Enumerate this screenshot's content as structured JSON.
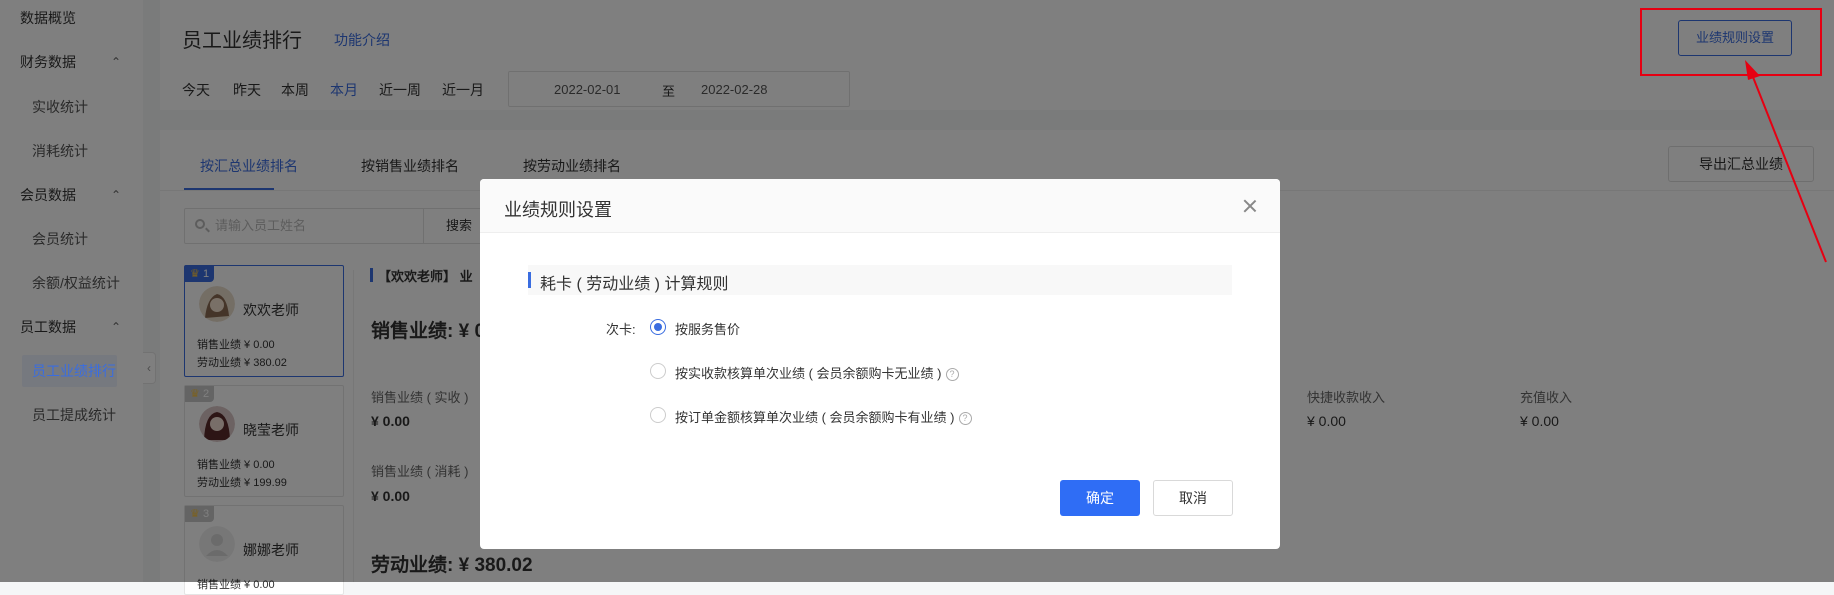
{
  "sidebar": {
    "items": [
      {
        "label": "数据概览"
      },
      {
        "label": "财务数据",
        "chevron": "chevron-up-icon"
      },
      {
        "label": "实收统计"
      },
      {
        "label": "消耗统计"
      },
      {
        "label": "会员数据",
        "chevron": "chevron-up-icon"
      },
      {
        "label": "会员统计"
      },
      {
        "label": "余额/权益统计"
      },
      {
        "label": "员工数据",
        "chevron": "chevron-up-icon"
      },
      {
        "label": "员工业绩排行",
        "active": true
      },
      {
        "label": "员工提成统计"
      }
    ],
    "collapse_glyph": "‹"
  },
  "header": {
    "title": "员工业绩排行",
    "help_link": "功能介绍",
    "quick_ranges": [
      "今天",
      "昨天",
      "本周",
      "本月",
      "近一周",
      "近一月"
    ],
    "active_range": "本月",
    "date_start": "2022-02-01",
    "date_separator": "至",
    "date_end": "2022-02-28",
    "rule_button": "业绩规则设置"
  },
  "tabs": {
    "items": [
      "按汇总业绩排名",
      "按销售业绩排名",
      "按劳动业绩排名"
    ],
    "active": "按汇总业绩排名",
    "export_button": "导出汇总业绩"
  },
  "search": {
    "placeholder": "请输入员工姓名",
    "button": "搜索"
  },
  "ranking": [
    {
      "rank": "1",
      "name": "欢欢老师",
      "sales": "销售业绩 ¥ 0.00",
      "labor": "劳动业绩 ¥ 380.02"
    },
    {
      "rank": "2",
      "name": "晓莹老师",
      "sales": "销售业绩 ¥ 0.00",
      "labor": "劳动业绩 ¥ 199.99"
    },
    {
      "rank": "3",
      "name": "娜娜老师",
      "sales": "销售业绩 ¥ 0.00",
      "labor": ""
    }
  ],
  "detail": {
    "staff_title": "【欢欢老师】 业",
    "sales_total_label": "销售业绩: ¥ 0",
    "sales_real_label": "销售业绩 ( 实收 )",
    "sales_real_value": "¥ 0.00",
    "sales_consume_label": "销售业绩 ( 消耗 )",
    "sales_consume_value": "¥ 0.00",
    "quick_income_label": "快捷收款收入",
    "quick_income_value": "¥ 0.00",
    "recharge_label": "充值收入",
    "recharge_value": "¥ 0.00",
    "labor_total_label": "劳动业绩: ¥ 380.02"
  },
  "modal": {
    "title": "业绩规则设置",
    "section": "耗卡 ( 劳动业绩 ) 计算规则",
    "field_label": "次卡:",
    "options": [
      {
        "label": "按服务售价",
        "selected": true,
        "help": false
      },
      {
        "label": "按实收款核算单次业绩 ( 会员余额购卡无业绩 )",
        "selected": false,
        "help": true
      },
      {
        "label": "按订单金额核算单次业绩 ( 会员余额购卡有业绩 )",
        "selected": false,
        "help": true
      }
    ],
    "help_glyph": "?",
    "confirm": "确定",
    "cancel": "取消"
  },
  "colors": {
    "accent": "#3a6de0",
    "primary_button": "#2f6df5",
    "annotation": "#e60012"
  }
}
